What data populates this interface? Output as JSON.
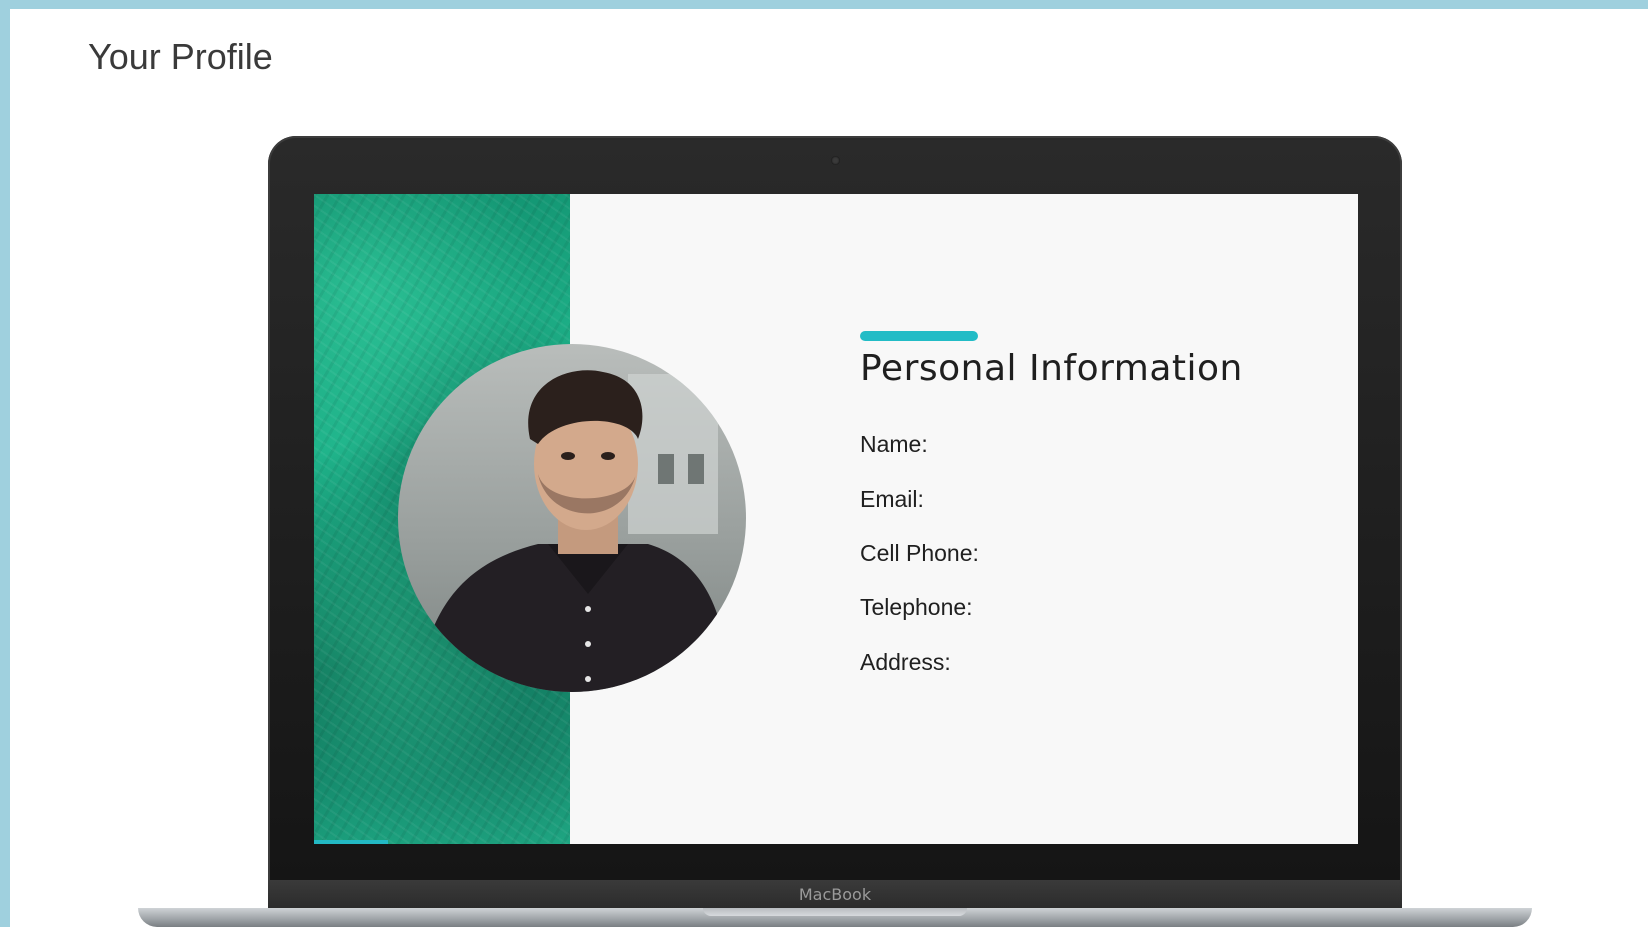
{
  "page": {
    "title": "Your Profile"
  },
  "card": {
    "heading": "Personal Information",
    "fields": {
      "name": "Name:",
      "email": "Email:",
      "cell_phone": "Cell Phone:",
      "telephone": "Telephone:",
      "address": "Address:"
    }
  },
  "device": {
    "brand": "MacBook"
  },
  "colors": {
    "accent": "#22bcc6",
    "frame": "#9fd0de",
    "panel_green": "#1fb38a"
  }
}
